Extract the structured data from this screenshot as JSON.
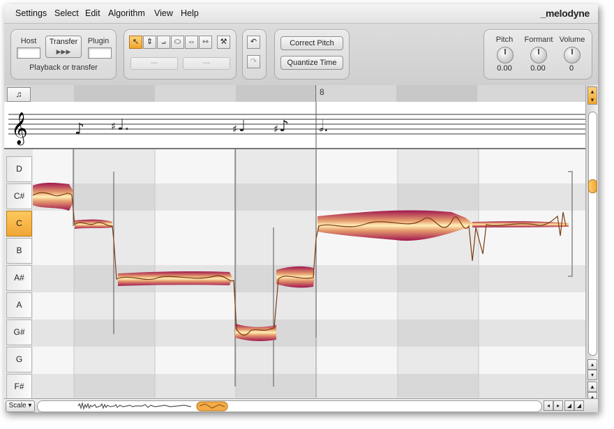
{
  "app": {
    "brand": "_melodyne"
  },
  "menu": [
    "Settings",
    "Select",
    "Edit",
    "Algorithm",
    "View",
    "Help"
  ],
  "transport": {
    "host_label": "Host",
    "transfer_label": "Transfer",
    "transfer_arrows": "▶▶▶",
    "plugin_label": "Plugin",
    "caption": "Playback or transfer"
  },
  "tools": {
    "field_left": "---",
    "field_right": "---"
  },
  "actions": {
    "correct_pitch": "Correct Pitch",
    "quantize_time": "Quantize Time"
  },
  "knobs": [
    {
      "label": "Pitch",
      "value": "0.00"
    },
    {
      "label": "Formant",
      "value": "0.00"
    },
    {
      "label": "Volume",
      "value": "0"
    }
  ],
  "ruler": {
    "bar_number": "8"
  },
  "pitch_keys": [
    {
      "label": "D",
      "selected": false
    },
    {
      "label": "C#",
      "selected": false
    },
    {
      "label": "C",
      "selected": true
    },
    {
      "label": "B",
      "selected": false
    },
    {
      "label": "A#",
      "selected": false
    },
    {
      "label": "A",
      "selected": false
    },
    {
      "label": "G#",
      "selected": false
    },
    {
      "label": "G",
      "selected": false
    },
    {
      "label": "F#",
      "selected": false
    }
  ],
  "footer": {
    "scale_label": "Scale ▾"
  },
  "colors": {
    "accent": "#f0a636",
    "blob_dark": "#a0164f",
    "blob_light": "#fff0b8",
    "pitch_line": "#7a3a10"
  }
}
